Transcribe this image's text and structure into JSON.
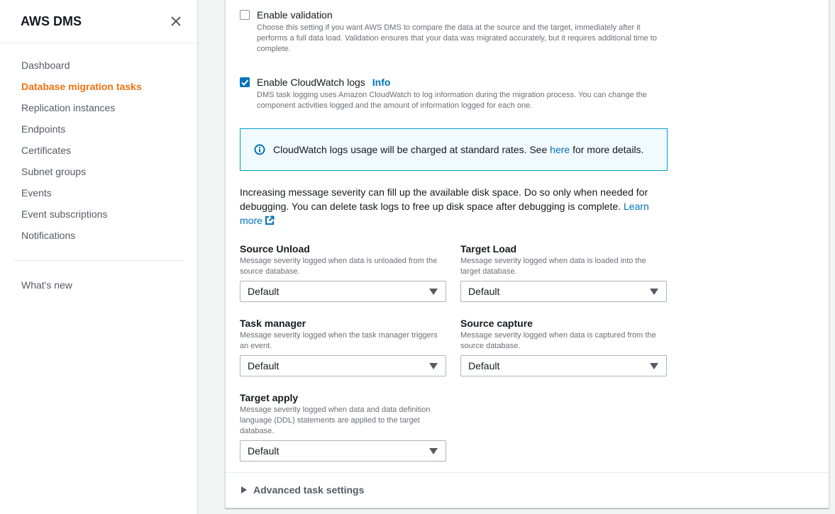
{
  "sidebar": {
    "title": "AWS DMS",
    "items": [
      {
        "label": "Dashboard",
        "active": false
      },
      {
        "label": "Database migration tasks",
        "active": true
      },
      {
        "label": "Replication instances",
        "active": false
      },
      {
        "label": "Endpoints",
        "active": false
      },
      {
        "label": "Certificates",
        "active": false
      },
      {
        "label": "Subnet groups",
        "active": false
      },
      {
        "label": "Events",
        "active": false
      },
      {
        "label": "Event subscriptions",
        "active": false
      },
      {
        "label": "Notifications",
        "active": false
      }
    ],
    "whats_new": "What's new"
  },
  "validation": {
    "label": "Enable validation",
    "checked": false,
    "description": "Choose this setting if you want AWS DMS to compare the data at the source and the target, immediately after it performs a full data load. Validation ensures that your data was migrated accurately, but it requires additional time to complete."
  },
  "cloudwatch": {
    "label": "Enable CloudWatch logs",
    "info": "Info",
    "checked": true,
    "description": "DMS task logging uses Amazon CloudWatch to log information during the migration process. You can change the component activities logged and the amount of information logged for each one."
  },
  "alert": {
    "text_before": "CloudWatch logs usage will be charged at standard rates. See ",
    "link": "here",
    "text_after": " for more details."
  },
  "severity_note": {
    "text": "Increasing message severity can fill up the available disk space. Do so only when needed for debugging. You can delete task logs to free up disk space after debugging is complete. ",
    "link": "Learn more"
  },
  "fields": {
    "source_unload": {
      "label": "Source Unload",
      "description": "Message severity logged when data is unloaded from the source database.",
      "value": "Default"
    },
    "target_load": {
      "label": "Target Load",
      "description": "Message severity logged when data is loaded into the target database.",
      "value": "Default"
    },
    "task_manager": {
      "label": "Task manager",
      "description": "Message severity logged when the task manager triggers an event.",
      "value": "Default"
    },
    "source_capture": {
      "label": "Source capture",
      "description": "Message severity logged when data is captured from the source database.",
      "value": "Default"
    },
    "target_apply": {
      "label": "Target apply",
      "description": "Message severity logged when data and data definition language (DDL) statements are applied to the target database.",
      "value": "Default"
    }
  },
  "advanced": {
    "label": "Advanced task settings"
  },
  "colors": {
    "accent": "#ec7211",
    "link": "#0073bb",
    "info_border": "#00a1c9",
    "info_bg": "#f1faff"
  }
}
